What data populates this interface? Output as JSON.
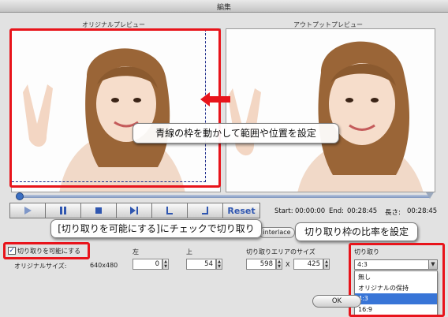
{
  "window": {
    "title": "編集"
  },
  "preview": {
    "original_label": "オリジナルプレビュー",
    "output_label": "アウトプットプレビュー"
  },
  "annotations": {
    "crop_frame": "青線の枠を動かして範囲や位置を設定",
    "enable_check": "[切り取りを可能にする]にチェックで切り取り",
    "ratio": "切り取り枠の比率を設定"
  },
  "controls": {
    "play_icon": "play-icon",
    "pause_icon": "pause-icon",
    "stop_icon": "stop-icon",
    "step_icon": "step-forward-icon",
    "mark_in_icon": "mark-in-icon",
    "mark_out_icon": "mark-out-icon",
    "reset_label": "Reset"
  },
  "time": {
    "start_label": "Start:",
    "start_value": "00:00:00",
    "end_label": "End:",
    "end_value": "00:28:45",
    "length_label": "長さ:",
    "length_value": "00:28:45"
  },
  "deinterlace_label": "interlace",
  "crop": {
    "enable_label": "切り取りを可能にする",
    "enabled": true,
    "original_size_label": "オリジナルサイズ:",
    "original_size_value": "640x480",
    "left_label": "左",
    "left_value": "0",
    "top_label": "上",
    "top_value": "54",
    "area_label": "切り取りエリアのサイズ",
    "width_value": "598",
    "x_sep": "X",
    "height_value": "425",
    "ratio_label": "切り取り",
    "ratio_selected": "4:3",
    "ratio_options": [
      "無し",
      "オリジナルの保持",
      "4:3",
      "16:9"
    ]
  },
  "ok_label": "OK",
  "colors": {
    "highlight": "#e8141b",
    "accent": "#3875d7",
    "crop_line": "#1b2a8a"
  }
}
